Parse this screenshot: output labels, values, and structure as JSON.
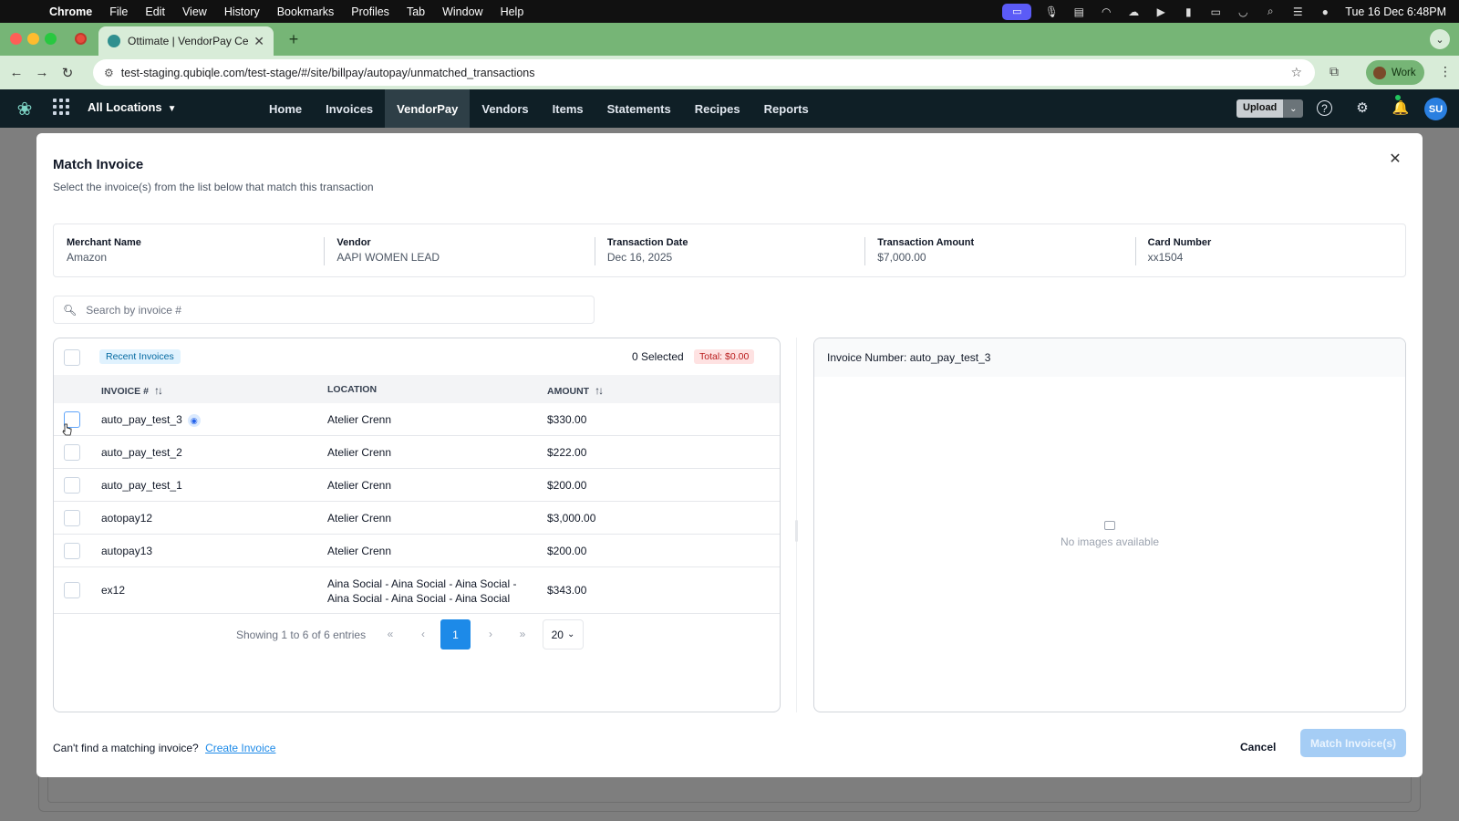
{
  "menubar": {
    "app": "Chrome",
    "items": [
      "File",
      "Edit",
      "View",
      "History",
      "Bookmarks",
      "Profiles",
      "Tab",
      "Window",
      "Help"
    ],
    "clock": "Tue 16 Dec  6:48PM"
  },
  "browser": {
    "tab_title": "Ottimate | VendorPay Center",
    "url": "test-staging.qubiqle.com/test-stage/#/site/billpay/autopay/unmatched_transactions",
    "profile": "Work"
  },
  "app": {
    "location": "All Locations",
    "nav": [
      "Home",
      "Invoices",
      "VendorPay",
      "Vendors",
      "Items",
      "Statements",
      "Recipes",
      "Reports"
    ],
    "active_nav": "VendorPay",
    "upload_label": "Upload",
    "avatar_initials": "SU"
  },
  "modal": {
    "title": "Match Invoice",
    "subtitle": "Select the invoice(s) from the list below that match this transaction",
    "info": [
      {
        "label": "Merchant Name",
        "value": "Amazon"
      },
      {
        "label": "Vendor",
        "value": "AAPI WOMEN LEAD"
      },
      {
        "label": "Transaction Date",
        "value": "Dec 16, 2025"
      },
      {
        "label": "Transaction Amount",
        "value": "$7,000.00"
      },
      {
        "label": "Card Number",
        "value": "xx1504"
      }
    ],
    "search_placeholder": "Search by invoice #",
    "recent_badge": "Recent Invoices",
    "selected_count": "0 Selected",
    "total_badge": "Total: $0.00",
    "columns": {
      "invoice": "INVOICE #",
      "location": "LOCATION",
      "amount": "AMOUNT"
    },
    "rows": [
      {
        "invoice": "auto_pay_test_3",
        "location": "Atelier Crenn",
        "amount": "$330.00"
      },
      {
        "invoice": "auto_pay_test_2",
        "location": "Atelier Crenn",
        "amount": "$222.00"
      },
      {
        "invoice": "auto_pay_test_1",
        "location": "Atelier Crenn",
        "amount": "$200.00"
      },
      {
        "invoice": "aotopay12",
        "location": "Atelier Crenn",
        "amount": "$3,000.00"
      },
      {
        "invoice": "autopay13",
        "location": "Atelier Crenn",
        "amount": "$200.00"
      },
      {
        "invoice": "ex12",
        "location_line1": "Aina Social - Aina Social - Aina Social -",
        "location_line2": "Aina Social - Aina Social - Aina Social",
        "amount": "$343.00"
      }
    ],
    "pagination": {
      "showing": "Showing 1 to 6 of 6 entries",
      "current_page": "1",
      "page_size": "20"
    },
    "preview_invoice": "Invoice Number: auto_pay_test_3",
    "no_images": "No images available",
    "footer_text": "Can't find a matching invoice?",
    "create_link": "Create Invoice",
    "cancel_label": "Cancel",
    "match_label": "Match Invoice(s)"
  },
  "colors": {
    "accent": "#1d8ae8",
    "tabstrip": "#76b576",
    "header": "#0f1f26",
    "overlay": "#7e7e7e"
  }
}
